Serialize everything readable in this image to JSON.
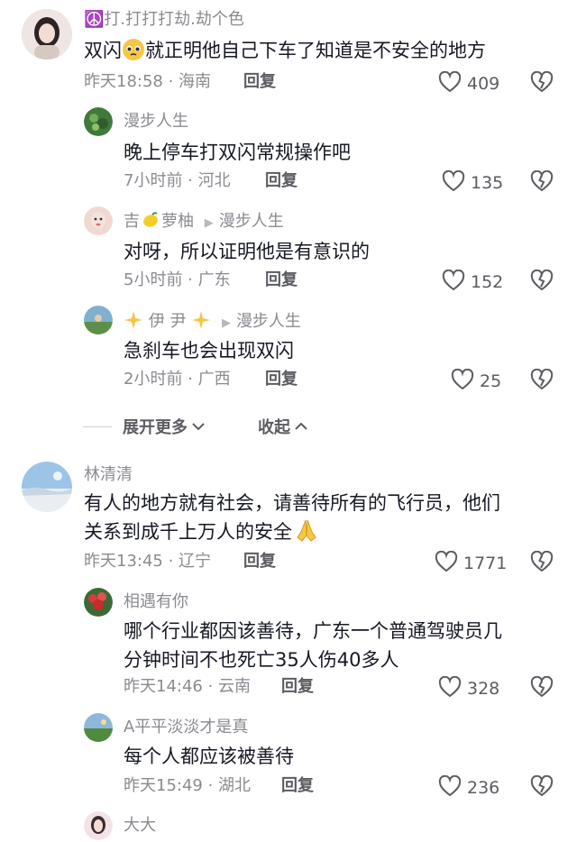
{
  "comments": [
    {
      "user": "☮️打.打打打劫.劫个色",
      "text_a": "双闪",
      "text_b": "就正明他自己下车了知道是不安全的地方",
      "time_loc": "昨天18:58 · 海南",
      "reply": "回复",
      "likes": "409"
    },
    {
      "user": "漫步人生",
      "text": "晚上停车打双闪常规操作吧",
      "time_loc": "7小时前 · 河北",
      "reply": "回复",
      "likes": "135"
    },
    {
      "user_a": "吉",
      "user_b": "萝柚",
      "reply_to": "漫步人生",
      "text": "对呀，所以证明他是有意识的",
      "time_loc": "5小时前 · 广东",
      "reply": "回复",
      "likes": "152"
    },
    {
      "user": "伊 尹",
      "reply_to": "漫步人生",
      "text": "急刹车也会出现双闪",
      "time_loc": "2小时前 · 广西",
      "reply": "回复",
      "likes": "25"
    },
    {
      "user": "林清清",
      "text_lines": [
        "有人的地方就有社会，请善待所有的飞行员，他们",
        "关系到成千上万人的安全"
      ],
      "time_loc": "昨天13:45 · 辽宁",
      "reply": "回复",
      "likes": "1771"
    },
    {
      "user": "相遇有你",
      "text_lines": [
        "哪个行业都因该善待，广东一个普通驾驶员几",
        "分钟时间不也死亡35人伤40多人"
      ],
      "time_loc": "昨天14:46 · 云南",
      "reply": "回复",
      "likes": "328"
    },
    {
      "user": "A平平淡淡才是真",
      "text": "每个人都应该被善待",
      "time_loc": "昨天15:49 · 湖北",
      "reply": "回复",
      "likes": "236"
    },
    {
      "user": "大大"
    }
  ],
  "thread": {
    "expand": "展开更多",
    "collapse": "收起"
  },
  "icons": {
    "like": "heart-outline-icon",
    "dislike": "heart-broken-outline-icon",
    "expand": "chevron-down-icon",
    "collapse": "chevron-up-icon"
  }
}
